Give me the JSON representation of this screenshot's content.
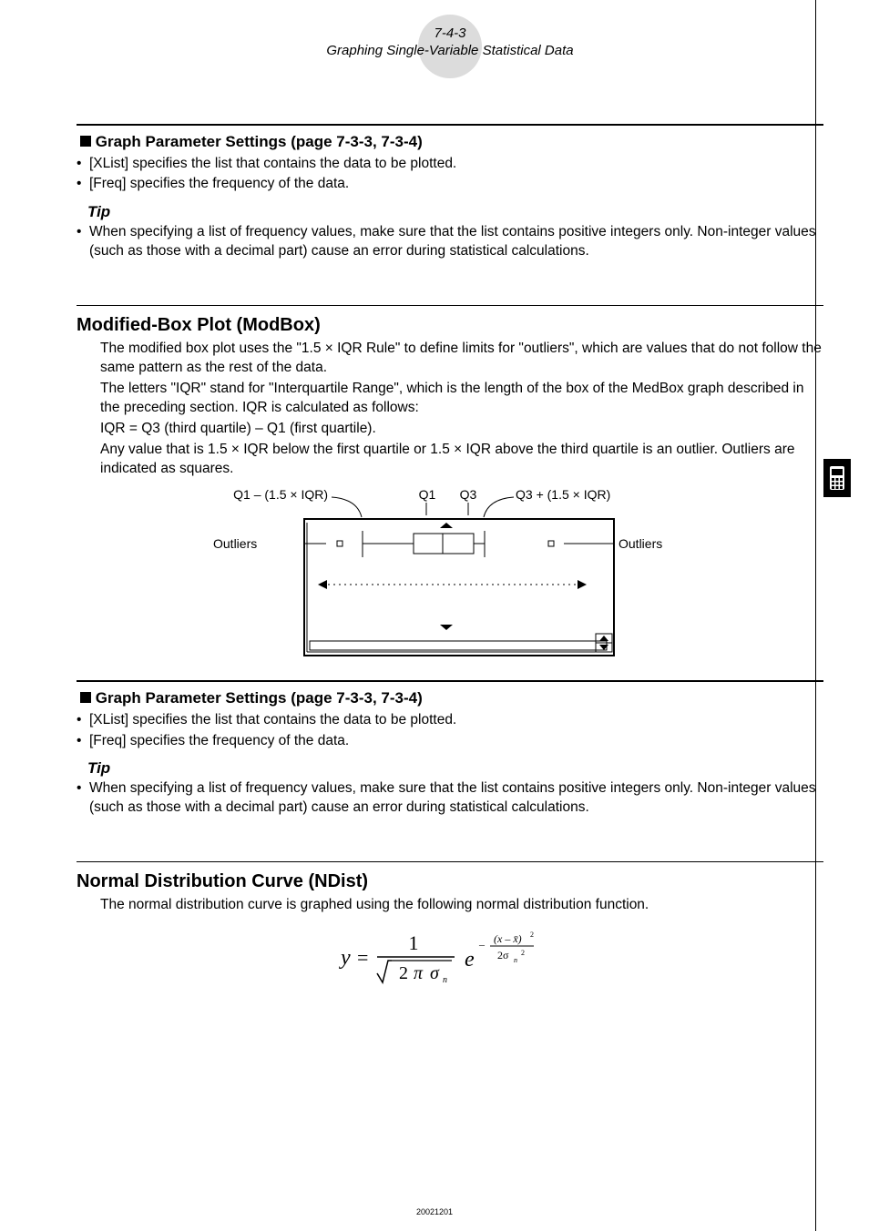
{
  "header": {
    "line1": "7-4-3",
    "line2": "Graphing Single-Variable Statistical Data"
  },
  "sec1": {
    "title": "Graph Parameter Settings (page 7-3-3, 7-3-4)",
    "b1": "[XList] specifies the list that contains the data to be plotted.",
    "b2": "[Freq] specifies the frequency of the data.",
    "tipLabel": "Tip",
    "tip": "When specifying a list of frequency values, make sure that the list contains positive integers only. Non-integer values (such as those with a decimal part) cause an error during statistical calculations."
  },
  "mod": {
    "title": "Modified-Box Plot (ModBox)",
    "p1": "The modified box plot uses the \"1.5 × IQR Rule\" to define limits for \"outliers\", which are values that do not follow the same pattern as the rest of the data.",
    "p2": "The letters \"IQR\" stand for \"Interquartile Range\", which is the length of the box of the MedBox graph described in the preceding section. IQR is calculated as follows:",
    "p3": "IQR = Q3 (third quartile) – Q1 (first quartile).",
    "p4": "Any value that is 1.5 × IQR below the first quartile or 1.5 × IQR above the third quartile is an outlier. Outliers are indicated as squares.",
    "labels": {
      "l1": "Q1 – (1.5 × IQR)",
      "l2": "Q1",
      "l3": "Q3",
      "l4": "Q3 + (1.5 × IQR)",
      "outL": "Outliers",
      "outR": "Outliers"
    }
  },
  "sec2": {
    "title": "Graph Parameter Settings (page 7-3-3, 7-3-4)",
    "b1": "[XList] specifies the list that contains the data to be plotted.",
    "b2": "[Freq] specifies the frequency of the data.",
    "tipLabel": "Tip",
    "tip": "When specifying a list of frequency values, make sure that the list contains positive integers only. Non-integer values (such as those with a decimal part) cause an error during statistical calculations."
  },
  "ndist": {
    "title": "Normal Distribution Curve (NDist)",
    "p1": "The normal distribution curve is graphed using the following normal distribution function."
  },
  "footer": "20021201"
}
